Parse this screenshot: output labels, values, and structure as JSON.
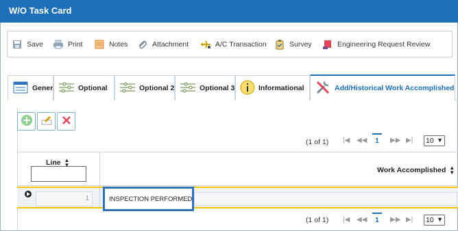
{
  "window": {
    "title": "W/O Task Card"
  },
  "toolbar": {
    "items": [
      {
        "label": "Save",
        "icon": "save-icon"
      },
      {
        "label": "Print",
        "icon": "printer-icon"
      },
      {
        "label": "Notes",
        "icon": "notes-icon"
      },
      {
        "label": "Attachment",
        "icon": "paperclip-icon"
      },
      {
        "label": "A/C Transaction",
        "icon": "aircraft-icon"
      },
      {
        "label": "Survey",
        "icon": "clipboard-icon"
      },
      {
        "label": "Engineering Request Review",
        "icon": "engineering-request-icon"
      }
    ]
  },
  "tabs": [
    {
      "label": "General",
      "icon": "form-icon"
    },
    {
      "label": "Optional",
      "icon": "sliders-icon"
    },
    {
      "label": "Optional 2",
      "icon": "sliders-icon"
    },
    {
      "label": "Optional 3",
      "icon": "sliders-icon"
    },
    {
      "label": "Informational",
      "icon": "info-icon"
    },
    {
      "label": "Add/Historical Work Accomplished",
      "icon": "tools-icon",
      "active": true
    }
  ],
  "actions": {
    "add": "add-icon",
    "edit": "edit-icon",
    "delete": "delete-icon"
  },
  "pager_top": {
    "range": "(1 of 1)",
    "page": "1",
    "rows": "10"
  },
  "pager_bottom": {
    "range": "(1 of 1)",
    "page": "1",
    "rows": "10"
  },
  "grid": {
    "columns": {
      "line": "Line",
      "work_accomplished": "Work Accomplished"
    },
    "rows": [
      {
        "line": "1",
        "work_accomplished": "INSPECTION PERFORMED"
      }
    ]
  },
  "colors": {
    "title_bar": "#1c6fb8",
    "selection": "#f2c200",
    "focus_outline": "#2e6fbe"
  }
}
